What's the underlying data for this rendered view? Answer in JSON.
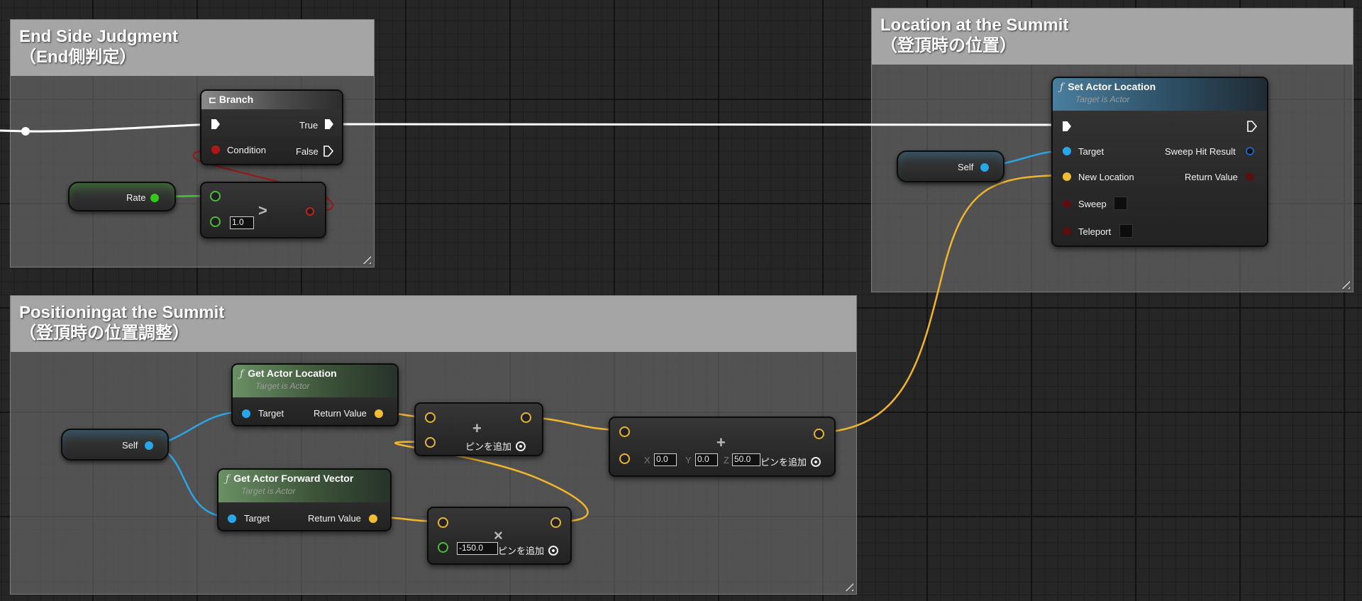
{
  "comments": {
    "end_side": {
      "title_line1": "End Side Judgment",
      "title_line2": "（End側判定）"
    },
    "location_summit": {
      "title_line1": "Location at the Summit",
      "title_line2": "（登頂時の位置）"
    },
    "positioning_summit": {
      "title_line1": "Positioningat the Summit",
      "title_line2": "（登頂時の位置調整）"
    }
  },
  "nodes": {
    "branch": {
      "title": "Branch",
      "true_label": "True",
      "false_label": "False",
      "condition_label": "Condition"
    },
    "rate_var": {
      "label": "Rate"
    },
    "greater": {
      "operator": ">",
      "value": "1.0"
    },
    "set_actor_location": {
      "title": "Set Actor Location",
      "subtitle": "Target is Actor",
      "target_label": "Target",
      "new_location_label": "New Location",
      "sweep_label": "Sweep",
      "teleport_label": "Teleport",
      "sweep_hit_result_label": "Sweep Hit Result",
      "return_value_label": "Return Value"
    },
    "self_top": {
      "label": "Self"
    },
    "self_bottom": {
      "label": "Self"
    },
    "get_actor_location": {
      "title": "Get Actor Location",
      "subtitle": "Target is Actor",
      "target_label": "Target",
      "return_value_label": "Return Value"
    },
    "get_actor_forward": {
      "title": "Get Actor Forward Vector",
      "subtitle": "Target is Actor",
      "target_label": "Target",
      "return_value_label": "Return Value"
    },
    "add_vec1": {
      "operator": "+",
      "add_pin": "ピンを追加"
    },
    "add_vec2": {
      "operator": "+",
      "add_pin": "ピンを追加",
      "x_label": "X",
      "x_value": "0.0",
      "y_label": "Y",
      "y_value": "0.0",
      "z_label": "Z",
      "z_value": "50.0"
    },
    "multiply": {
      "operator": "×",
      "value": "-150.0",
      "add_pin": "ピンを追加"
    }
  },
  "colors": {
    "exec_wire": "#ffffff",
    "vector_wire": "#f0b52f",
    "object_wire": "#2aa6e6",
    "float_wire": "#47c436",
    "bool_wire": "#a01515"
  },
  "icons": [
    "branch-icon",
    "function-icon",
    "exec-pin-icon",
    "resize-handle-icon",
    "add-pin-icon"
  ]
}
